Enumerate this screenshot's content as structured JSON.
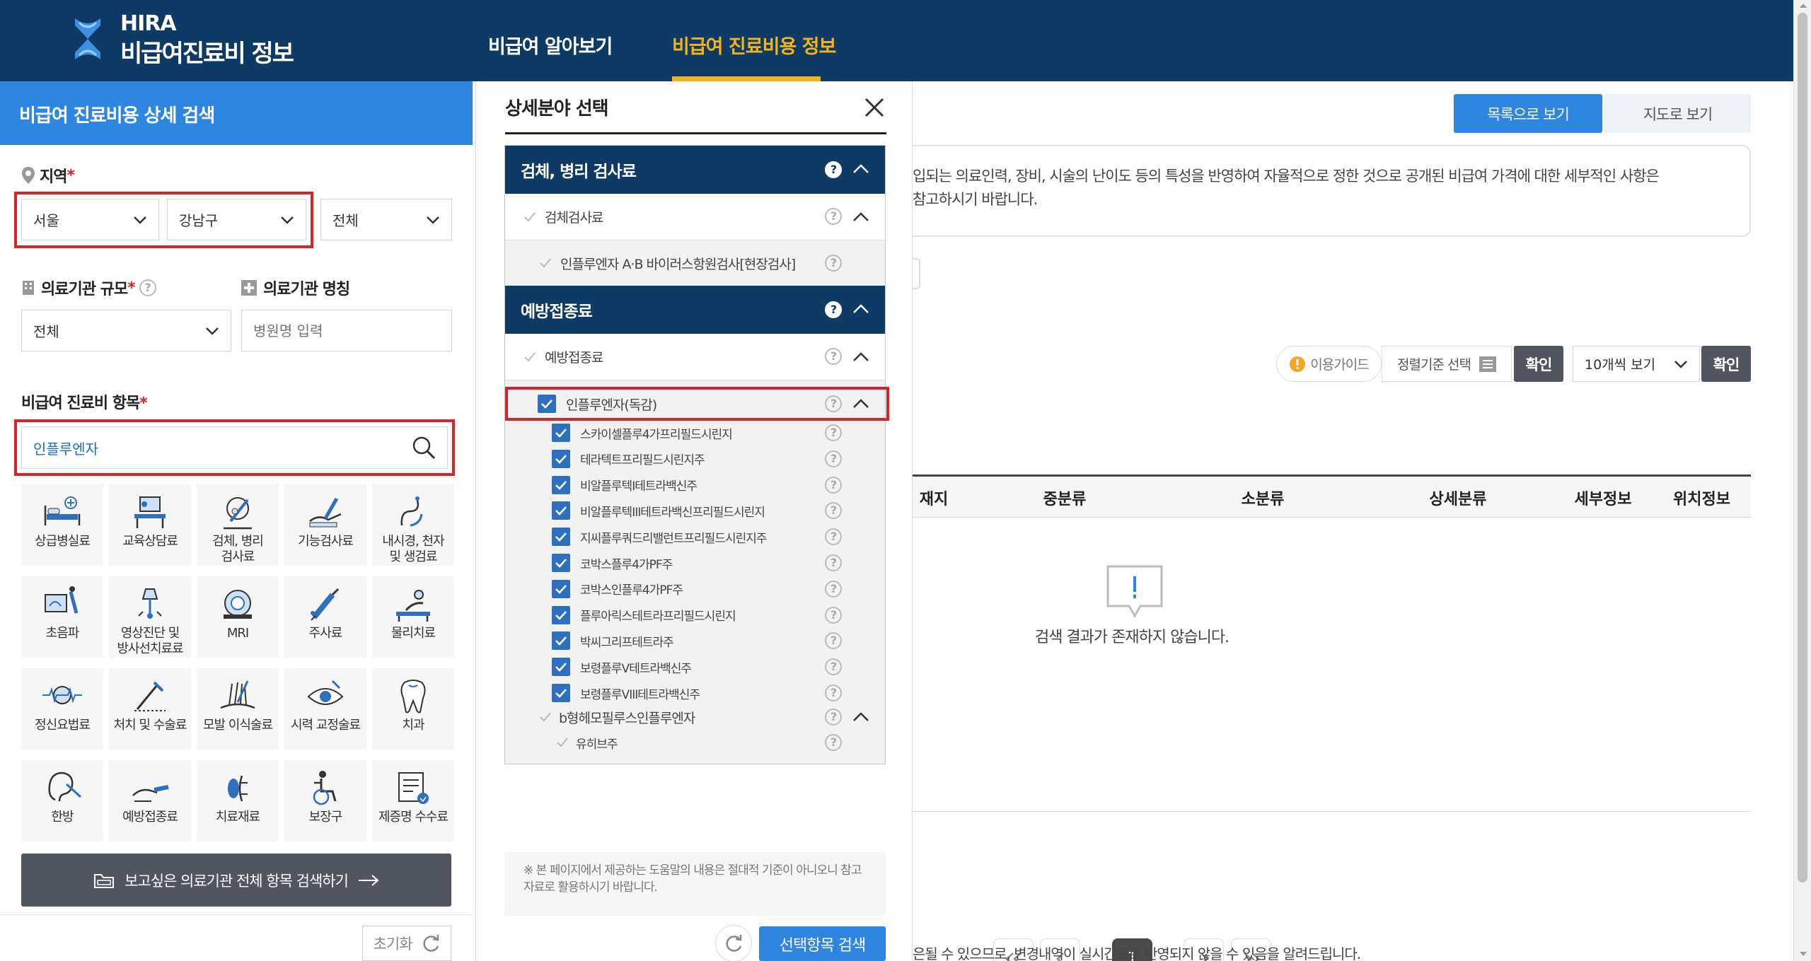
{
  "header": {
    "logo_abbr": "HIRA",
    "logo_title": "비급여진료비 정보",
    "nav": [
      {
        "label": "비급여 알아보기",
        "active": false
      },
      {
        "label": "비급여 진료비용 정보",
        "active": true
      }
    ],
    "colors": {
      "header_bg": "#0d3b66",
      "active_nav": "#f5b31b",
      "accent_blue": "#2f86e0",
      "highlight_red": "#d9232a"
    }
  },
  "left_panel": {
    "title": "비급여 진료비용 상세 검색",
    "region": {
      "label": "지역",
      "required_mark": "*",
      "sido": "서울",
      "sigungu": "강남구",
      "dong": "전체"
    },
    "scale": {
      "label": "의료기관 규모",
      "required_mark": "*",
      "value": "전체"
    },
    "name": {
      "label": "의료기관 명칭",
      "placeholder": "병원명 입력"
    },
    "items": {
      "label": "비급여 진료비 항목",
      "required_mark": "*",
      "search_value": "인플루엔자"
    },
    "categories": [
      {
        "label": "상급병실료",
        "icon": "hospital-bed-icon"
      },
      {
        "label": "교육상담료",
        "icon": "consultation-icon"
      },
      {
        "label": "검체, 병리\n검사료",
        "icon": "microscope-icon"
      },
      {
        "label": "기능검사료",
        "icon": "function-test-icon"
      },
      {
        "label": "내시경, 천자\n및 생검료",
        "icon": "endoscope-icon"
      },
      {
        "label": "초음파",
        "icon": "ultrasound-icon"
      },
      {
        "label": "영상진단 및\n방사선치료료",
        "icon": "radiology-icon"
      },
      {
        "label": "MRI",
        "icon": "mri-icon"
      },
      {
        "label": "주사료",
        "icon": "syringe-icon"
      },
      {
        "label": "물리치료",
        "icon": "physical-therapy-icon"
      },
      {
        "label": "정신요법료",
        "icon": "brain-wave-icon"
      },
      {
        "label": "처치 및 수술료",
        "icon": "surgery-icon"
      },
      {
        "label": "모발 이식술료",
        "icon": "hair-transplant-icon"
      },
      {
        "label": "시력 교정술료",
        "icon": "eye-icon"
      },
      {
        "label": "치과",
        "icon": "tooth-icon"
      },
      {
        "label": "한방",
        "icon": "ear-acupuncture-icon"
      },
      {
        "label": "예방접종료",
        "icon": "vaccination-icon"
      },
      {
        "label": "치료재료",
        "icon": "medical-material-icon"
      },
      {
        "label": "보장구",
        "icon": "wheelchair-icon"
      },
      {
        "label": "제증명 수수료",
        "icon": "certificate-icon"
      }
    ],
    "search_all_button": "보고싶은 의료기관 전체 항목 검색하기",
    "reset_button": "초기화"
  },
  "modal": {
    "title": "상세분야 선택",
    "groups": [
      {
        "title": "검체, 병리 검사료",
        "sub": "검체검사료",
        "subsub": "인플루엔자 A·B 바이러스항원검사[현장검사]"
      },
      {
        "title": "예방접종료",
        "sub": "예방접종료",
        "selected": "인플루엔자(독감)"
      }
    ],
    "checked_items": [
      "스카이셀플루4가프리필드시린지",
      "테라텍트프리필드시린지주",
      "비알플루텍I테트라백신주",
      "비알플루텍III테트라백신프리필드시린지",
      "지씨플루쿼드리밸런트프리필드시린지주",
      "코박스플루4가PF주",
      "코박스인플루4가PF주",
      "플루아릭스테트라프리필드시린지",
      "박씨그리프테트라주",
      "보령플루V테트라백신주",
      "보령플루VIII테트라백신주"
    ],
    "subgroup": "b형헤모필루스인플루엔자",
    "subgroup_item": "유히브주",
    "notice": "※ 본 페이지에서 제공하는 도움말의 내용은 절대적 기준이 아니오니 참고자료로 활용하시기 바랍니다.",
    "search_button": "선택항목 검색"
  },
  "main": {
    "view_list_button": "목록으로 보기",
    "view_map_button": "지도로 보기",
    "notice_line1": "입되는 의료인력, 장비, 시술의 난이도 등의 특성을 반영하여 자율적으로 정한 것으로 공개된 비급여 가격에 대한 세부적인 사항은",
    "notice_line2": "참고하시기 바랍니다.",
    "guide_button": "이용가이드",
    "sort_select": "정렬기준 선택",
    "confirm_button": "확인",
    "per_page_select": "10개씩 보기",
    "confirm_button2": "확인",
    "table_headers": [
      "재지",
      "중분류",
      "소분류",
      "상세분류",
      "세부정보",
      "위치정보"
    ],
    "empty_message": "검색 결과가 존재하지 않습니다.",
    "pagination": {
      "current": "1"
    },
    "footer_text": "은될 수 있으므로, 변경내역이 실시간으로 반영되지 않을 수 있음을 알려드립니다."
  }
}
